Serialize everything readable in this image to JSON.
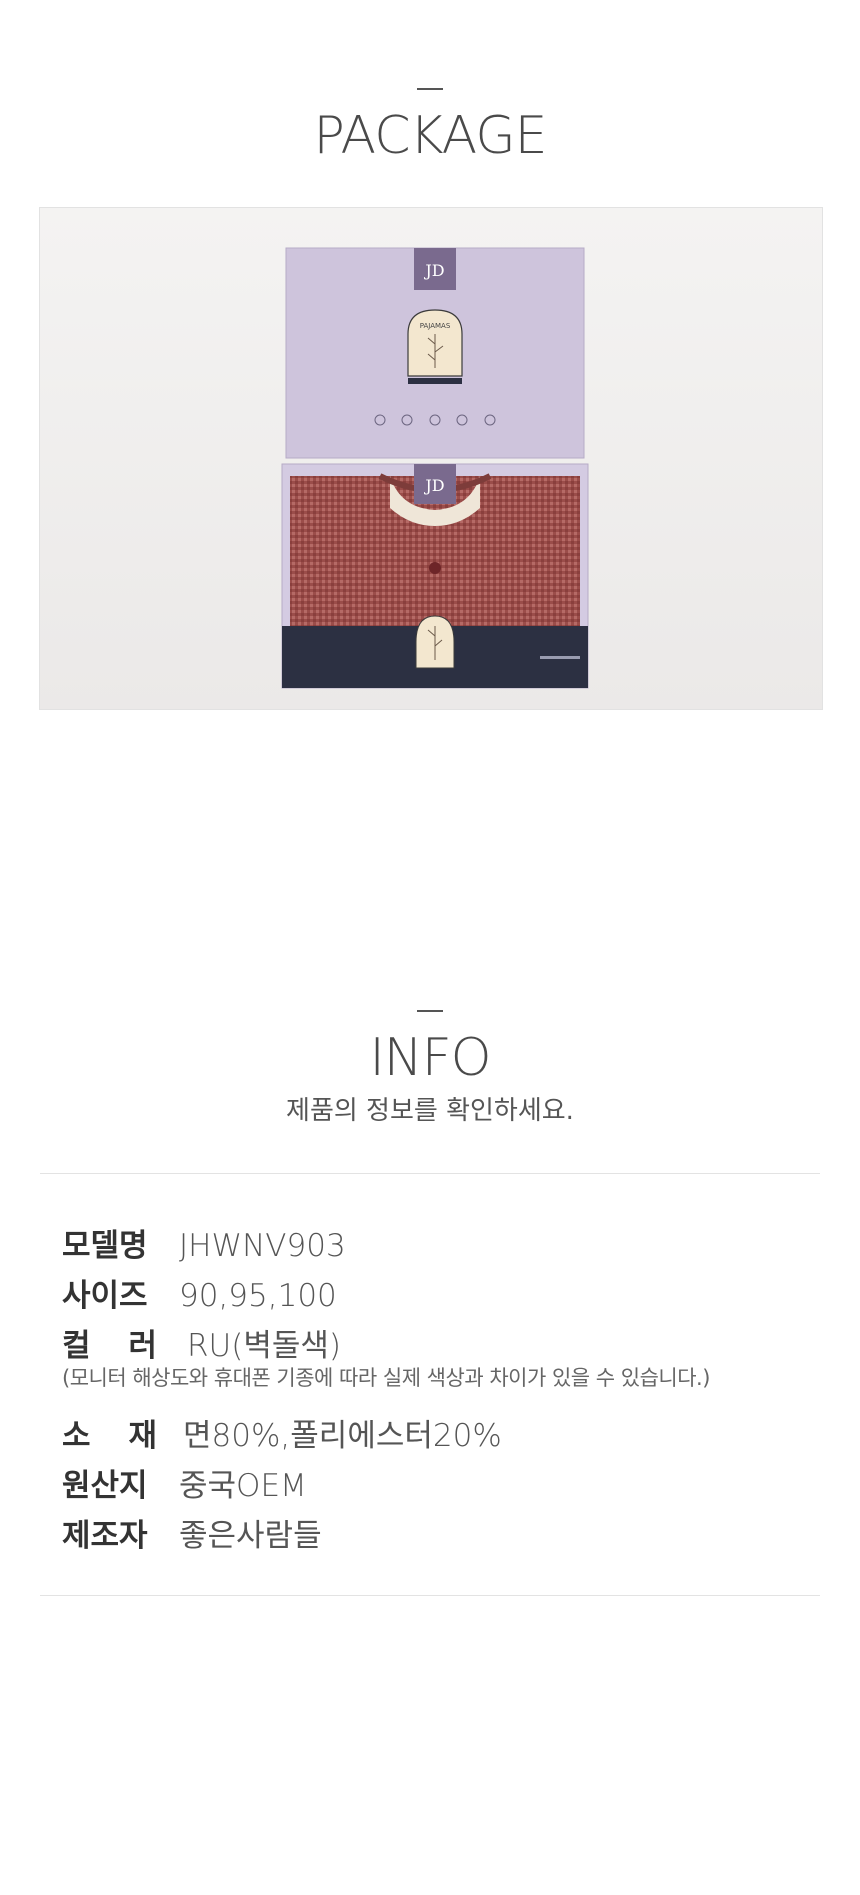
{
  "package": {
    "title": "PACKAGE",
    "box_logo": "JD",
    "box_tag": "PAJAMAS"
  },
  "info": {
    "title": "INFO",
    "subtitle": "제품의 정보를 확인하세요.",
    "rows": [
      {
        "label": "모델명",
        "value": "JHWNV903"
      },
      {
        "label": "사이즈",
        "value": "90,95,100"
      },
      {
        "label_chars": [
          "컬",
          "러"
        ],
        "value": "RU(벽돌색)"
      },
      {
        "label_chars": [
          "소",
          "재"
        ],
        "value": "면80%,폴리에스터20%"
      },
      {
        "label": "원산지",
        "value": "중국OEM"
      },
      {
        "label": "제조자",
        "value": "좋은사람들"
      }
    ],
    "color_note": "(모니터 해상도와 휴대폰 기종에 따라 실제 색상과 차이가 있을 수 있습니다.)"
  },
  "colors": {
    "box_lavender": "#cfc6de",
    "logo_purple": "#7a6a8e",
    "band_navy": "#2c3042",
    "garment_red": "#9b4d4a"
  }
}
